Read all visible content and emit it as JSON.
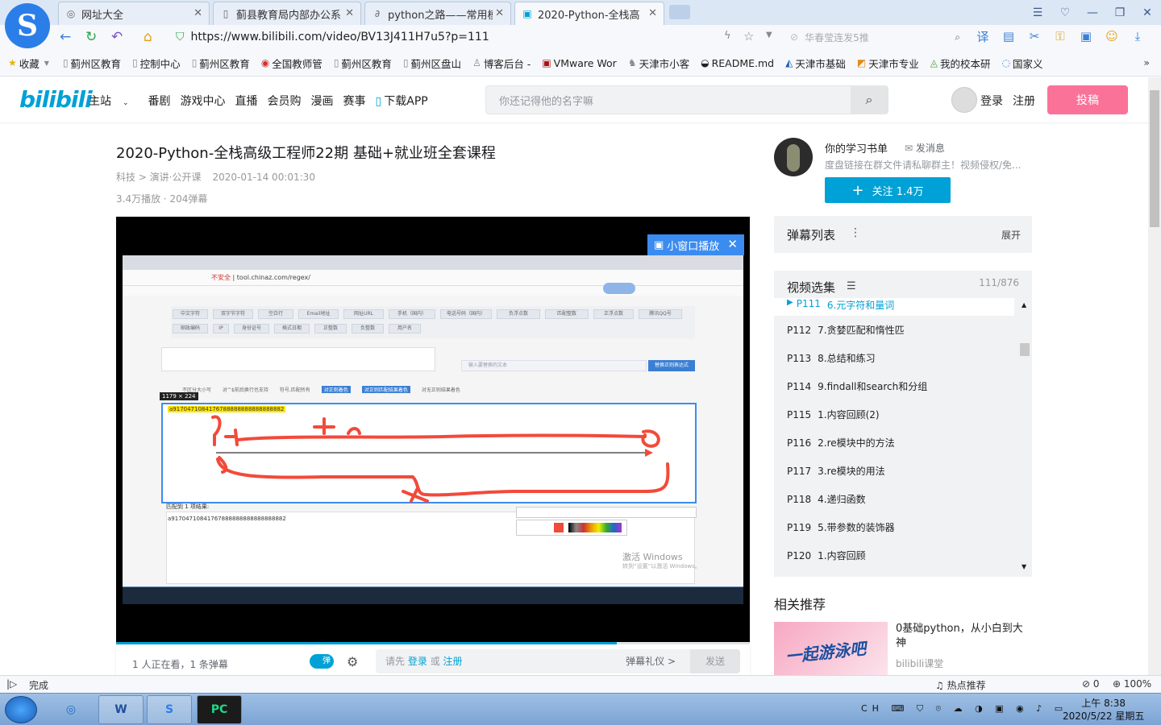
{
  "browser": {
    "tabs": [
      {
        "label": "网址大全"
      },
      {
        "label": "蓟县教育局内部办公系统"
      },
      {
        "label": "python之路——常用模块"
      },
      {
        "label": "2020-Python-全栈高"
      }
    ],
    "url": "https://www.bilibili.com/video/BV13J411H7u5?p=111",
    "search_placeholder": "华春莹连发5推",
    "bookmarks": [
      "收藏",
      "蓟州区教育",
      "控制中心",
      "蓟州区教育",
      "全国教师管",
      "蓟州区教育",
      "蓟州区盘山",
      "博客后台 -",
      "VMware Wor",
      "天津市小客",
      "README.md",
      "天津市基础",
      "天津市专业",
      "我的校本研",
      "国家义"
    ]
  },
  "site": {
    "logo": "bilibili",
    "nav": [
      "主站",
      "番剧",
      "游戏中心",
      "直播",
      "会员购",
      "漫画",
      "赛事",
      "下载APP"
    ],
    "search_placeholder": "你还记得他的名字嘛",
    "login": "登录",
    "register": "注册",
    "upload": "投稿"
  },
  "video": {
    "title": "2020-Python-全栈高级工程师22期 基础+就业班全套课程",
    "category": "科技 > 演讲·公开课",
    "date": "2020-01-14 00:01:30",
    "stats": "3.4万播放 · 204弹幕",
    "progress": 0.79,
    "pip_label": "小窗口播放",
    "screen": {
      "url": "tool.chinaz.com/regex/",
      "insecure": "不安全",
      "size_badge": "1179 × 224",
      "highlight": "a9170471084176788888888888888882",
      "match_label": "匹配到 1 项结果:",
      "match_text": "a91704710841767888888888888888882",
      "activate1": "激活 Windows",
      "activate2": "转到“设置”以激活 Windows。",
      "regex_btn": "替换正则表达式",
      "search_hint": "输入要替换的文本",
      "chips": [
        "中文字符",
        "双字节字符",
        "空白行",
        "Email地址",
        "网址URL",
        "手机（国内）",
        "电话号码（国内）",
        "负浮点数",
        "匹配整数",
        "正浮点数",
        "腾讯QQ号",
        "邮政编码",
        "IP",
        "身份证号",
        "格式日期",
        "正整数",
        "负整数",
        "用户名"
      ],
      "options": [
        "不区分大小写",
        "对^$前后换行也支持",
        "符号,匹配所有",
        "对正则着色",
        "对正则匹配结果着色",
        "对无正则结果着色"
      ]
    }
  },
  "danmaku_bar": {
    "watching": "1 人正在看，1 条弹幕",
    "toggle": "弹",
    "prompt": "请先",
    "login": "登录",
    "or": "或",
    "register": "注册",
    "etiquette": "弹幕礼仪 >",
    "send": "发送"
  },
  "uploader": {
    "name": "你的学习书单",
    "message": "发消息",
    "desc": "度盘链接在群文件请私聊群主！视频侵权/免...",
    "follow": "关注 1.4万"
  },
  "danmaku_list": {
    "title": "弹幕列表",
    "expand": "展开"
  },
  "episodes": {
    "title": "视频选集",
    "count": "111/876",
    "items": [
      {
        "p": "P111",
        "t": "6.元字符和量词"
      },
      {
        "p": "P112",
        "t": "7.贪婪匹配和惰性匹"
      },
      {
        "p": "P113",
        "t": "8.总结和练习"
      },
      {
        "p": "P114",
        "t": "9.findall和search和分组"
      },
      {
        "p": "P115",
        "t": "1.内容回顾(2)"
      },
      {
        "p": "P116",
        "t": "2.re模块中的方法"
      },
      {
        "p": "P117",
        "t": "3.re模块的用法"
      },
      {
        "p": "P118",
        "t": "4.递归函数"
      },
      {
        "p": "P119",
        "t": "5.带参数的装饰器"
      },
      {
        "p": "P120",
        "t": "1.内容回顾"
      }
    ]
  },
  "recommend": {
    "title": "相关推荐",
    "item_title": "0基础python，从小白到大神",
    "item_up": "bilibili课堂",
    "thumb_text": "一起游泳吧"
  },
  "statusbar": {
    "done": "完成",
    "hot": "热点推荐",
    "count": "0",
    "zoom": "100%"
  },
  "taskbar": {
    "time": "上午 8:38",
    "date": "2020/5/22 星期五",
    "ime": "CH"
  }
}
